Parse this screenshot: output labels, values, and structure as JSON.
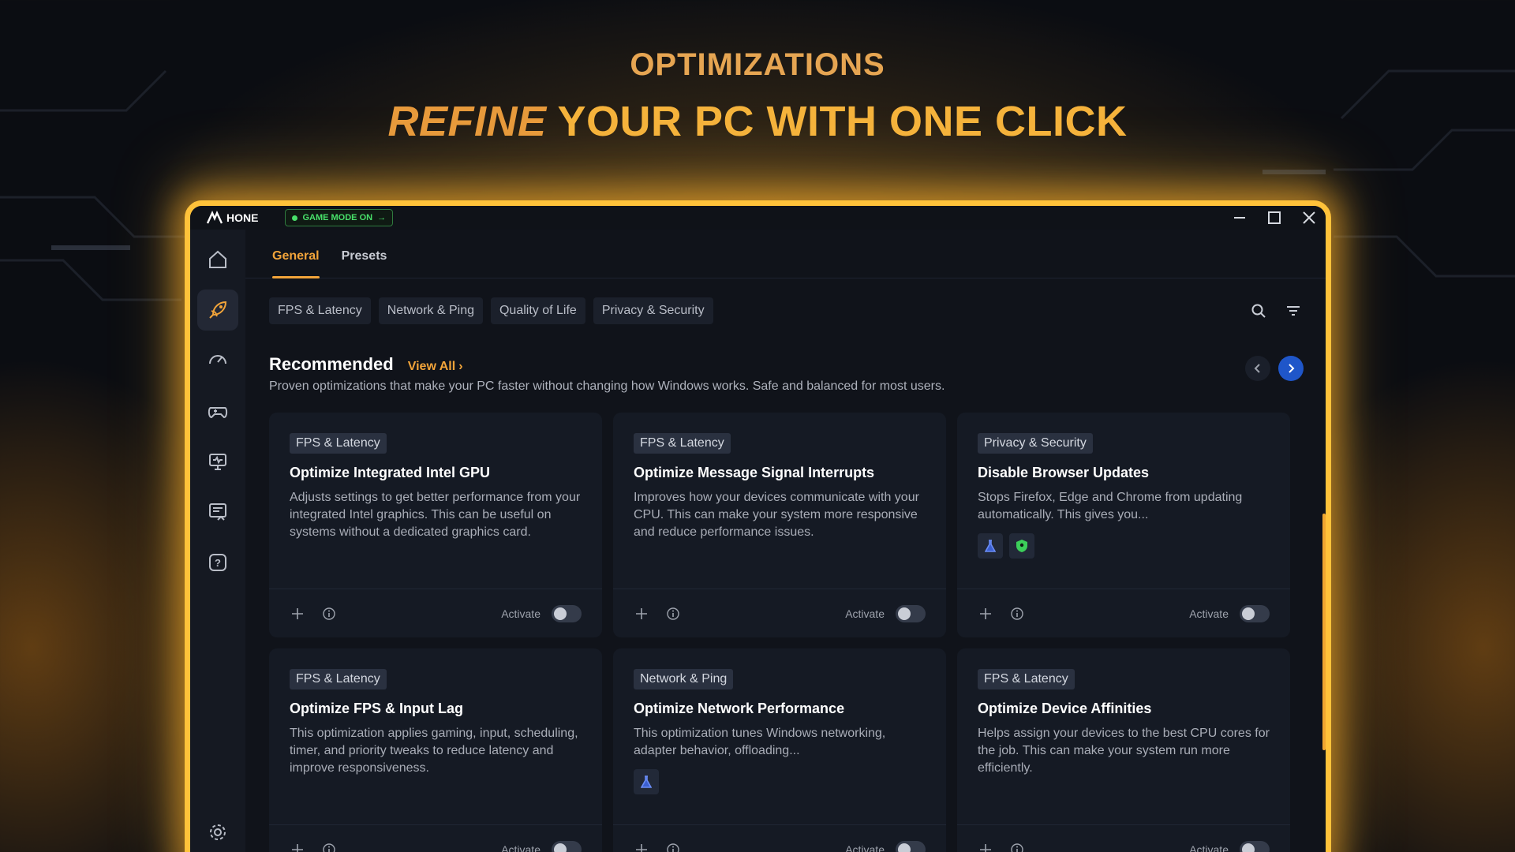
{
  "hero": {
    "subtitle": "OPTIMIZATIONS",
    "title_em": "REFINE",
    "title_rest": "YOUR PC WITH ONE CLICK"
  },
  "titlebar": {
    "logo": "HONE",
    "game_mode": "GAME MODE ON"
  },
  "sidebar": {
    "items": [
      {
        "icon": "home-icon"
      },
      {
        "icon": "rocket-icon"
      },
      {
        "icon": "speedometer-icon"
      },
      {
        "icon": "gamepad-icon"
      },
      {
        "icon": "monitor-icon"
      },
      {
        "icon": "benchmark-icon"
      },
      {
        "icon": "help-icon"
      },
      {
        "icon": "gear-icon"
      }
    ]
  },
  "tabs": [
    "General",
    "Presets"
  ],
  "filters": [
    "FPS & Latency",
    "Network & Ping",
    "Quality of Life",
    "Privacy & Security"
  ],
  "recommended": {
    "title": "Recommended",
    "view_all": "View All",
    "description": "Proven optimizations that make your PC faster without changing how Windows works. Safe and balanced for most users."
  },
  "activate_label": "Activate",
  "cards": [
    {
      "tag": "FPS & Latency",
      "title": "Optimize Integrated Intel GPU",
      "description": "Adjusts settings to get better performance from your integrated Intel graphics. This can be useful on systems without a dedicated graphics card."
    },
    {
      "tag": "FPS & Latency",
      "title": "Optimize Message Signal Interrupts",
      "description": "Improves how your devices communicate with your CPU. This can make your system more responsive and reduce performance issues."
    },
    {
      "tag": "Privacy & Security",
      "title": "Disable Browser Updates",
      "description": "Stops Firefox, Edge and Chrome from updating automatically. This gives you...",
      "badges": [
        "flask-icon",
        "shield-icon"
      ]
    },
    {
      "tag": "FPS & Latency",
      "title": "Optimize FPS & Input Lag",
      "description": "This optimization applies gaming, input, scheduling, timer, and priority tweaks to reduce latency and improve responsiveness."
    },
    {
      "tag": "Network & Ping",
      "title": "Optimize Network Performance",
      "description": "This optimization tunes Windows networking, adapter behavior, offloading...",
      "badges": [
        "flask-icon"
      ]
    },
    {
      "tag": "FPS & Latency",
      "title": "Optimize Device Affinities",
      "description": "Helps assign your devices to the best CPU cores for the job. This can make your system run more efficiently."
    }
  ],
  "colors": {
    "accent": "#f2a43a",
    "glow": "#ffc23a",
    "game_mode_green": "#48e06a",
    "next_button_blue": "#1f56c9"
  }
}
